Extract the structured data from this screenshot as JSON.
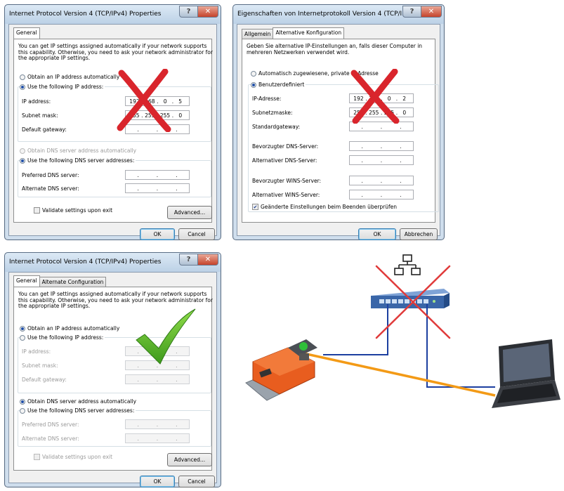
{
  "dlg1": {
    "title": "Internet Protocol Version 4 (TCP/IPv4) Properties",
    "help": "?",
    "close": "✕",
    "tab_general": "General",
    "description": "You can get IP settings assigned automatically if your network supports this capability. Otherwise, you need to ask your network administrator for the appropriate IP settings.",
    "obtain_ip_auto": "Obtain an IP address automatically",
    "use_following_ip": "Use the following IP address:",
    "ip_label": "IP address:",
    "ip_value": [
      "192",
      "168",
      "0",
      "5"
    ],
    "mask_label": "Subnet mask:",
    "mask_value": [
      "255",
      "255",
      "255",
      "0"
    ],
    "gateway_label": "Default gateway:",
    "obtain_dns_auto": "Obtain DNS server address automatically",
    "use_following_dns": "Use the following DNS server addresses:",
    "pref_dns_label": "Preferred DNS server:",
    "alt_dns_label": "Alternate DNS server:",
    "validate": "Validate settings upon exit",
    "advanced": "Advanced...",
    "ok": "OK",
    "cancel": "Cancel"
  },
  "dlg2": {
    "title": "Eigenschaften von Internetprotokoll Version 4 (TCP/IPv4)",
    "help": "?",
    "close": "✕",
    "tab_general": "Allgemein",
    "tab_alt": "Alternative Konfiguration",
    "description": "Geben Sie alternative IP-Einstellungen an, falls dieser Computer in mehreren Netzwerken verwendet wird.",
    "auto_private": "Automatisch zugewiesene, private IP-Adresse",
    "user_defined": "Benutzerdefiniert",
    "ip_label": "IP-Adresse:",
    "ip_value": [
      "192",
      "168",
      "0",
      "2"
    ],
    "mask_label": "Subnetzmaske:",
    "mask_value": [
      "255",
      "255",
      "255",
      "0"
    ],
    "gateway_label": "Standardgateway:",
    "pref_dns_label": "Bevorzugter DNS-Server:",
    "alt_dns_label": "Alternativer DNS-Server:",
    "pref_wins_label": "Bevorzugter WINS-Server:",
    "alt_wins_label": "Alternativer WINS-Server:",
    "validate": "Geänderte Einstellungen beim Beenden überprüfen",
    "ok": "OK",
    "cancel": "Abbrechen"
  },
  "dlg3": {
    "title": "Internet Protocol Version 4 (TCP/IPv4) Properties",
    "help": "?",
    "close": "✕",
    "tab_general": "General",
    "tab_alt": "Alternate Configuration",
    "description": "You can get IP settings assigned automatically if your network supports this capability. Otherwise, you need to ask your network administrator for the appropriate IP settings.",
    "obtain_ip_auto": "Obtain an IP address automatically",
    "use_following_ip": "Use the following IP address:",
    "ip_label": "IP address:",
    "mask_label": "Subnet mask:",
    "gateway_label": "Default gateway:",
    "obtain_dns_auto": "Obtain DNS server address automatically",
    "use_following_dns": "Use the following DNS server addresses:",
    "pref_dns_label": "Preferred DNS server:",
    "alt_dns_label": "Alternate DNS server:",
    "validate": "Validate settings upon exit",
    "advanced": "Advanced...",
    "ok": "OK",
    "cancel": "Cancel"
  },
  "colors": {
    "cross": "#d9252c",
    "check": "#58b82a",
    "cable_orange": "#f39a16",
    "cable_blue": "#1c3fa0",
    "switch": "#3a66a8"
  },
  "icons": [
    "red-x-icon",
    "green-check-icon",
    "network-topology-icon",
    "network-switch-icon",
    "actuator-device-icon",
    "laptop-icon"
  ]
}
